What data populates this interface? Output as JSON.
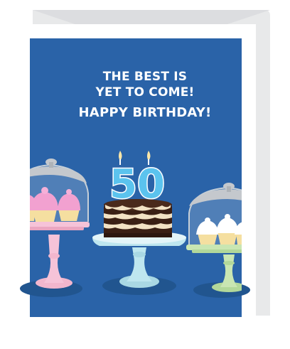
{
  "card": {
    "line1": "THE BEST IS",
    "line2": "YET TO COME!",
    "line3": "HAPPY BIRTHDAY!",
    "candle_number": "50"
  },
  "colors": {
    "card_background": "#2A63A8",
    "envelope": "#E8E9EA",
    "number_blue": "#5BC3EE",
    "chocolate": "#3A1F14",
    "frosting": "#F2E2C4",
    "cupcake_pink": "#F08DC6",
    "stand_pink": "#F6C3D8",
    "stand_blue": "#BEE6EF",
    "stand_green": "#C9E6B2",
    "dome_gray": "#BFC2C6"
  }
}
